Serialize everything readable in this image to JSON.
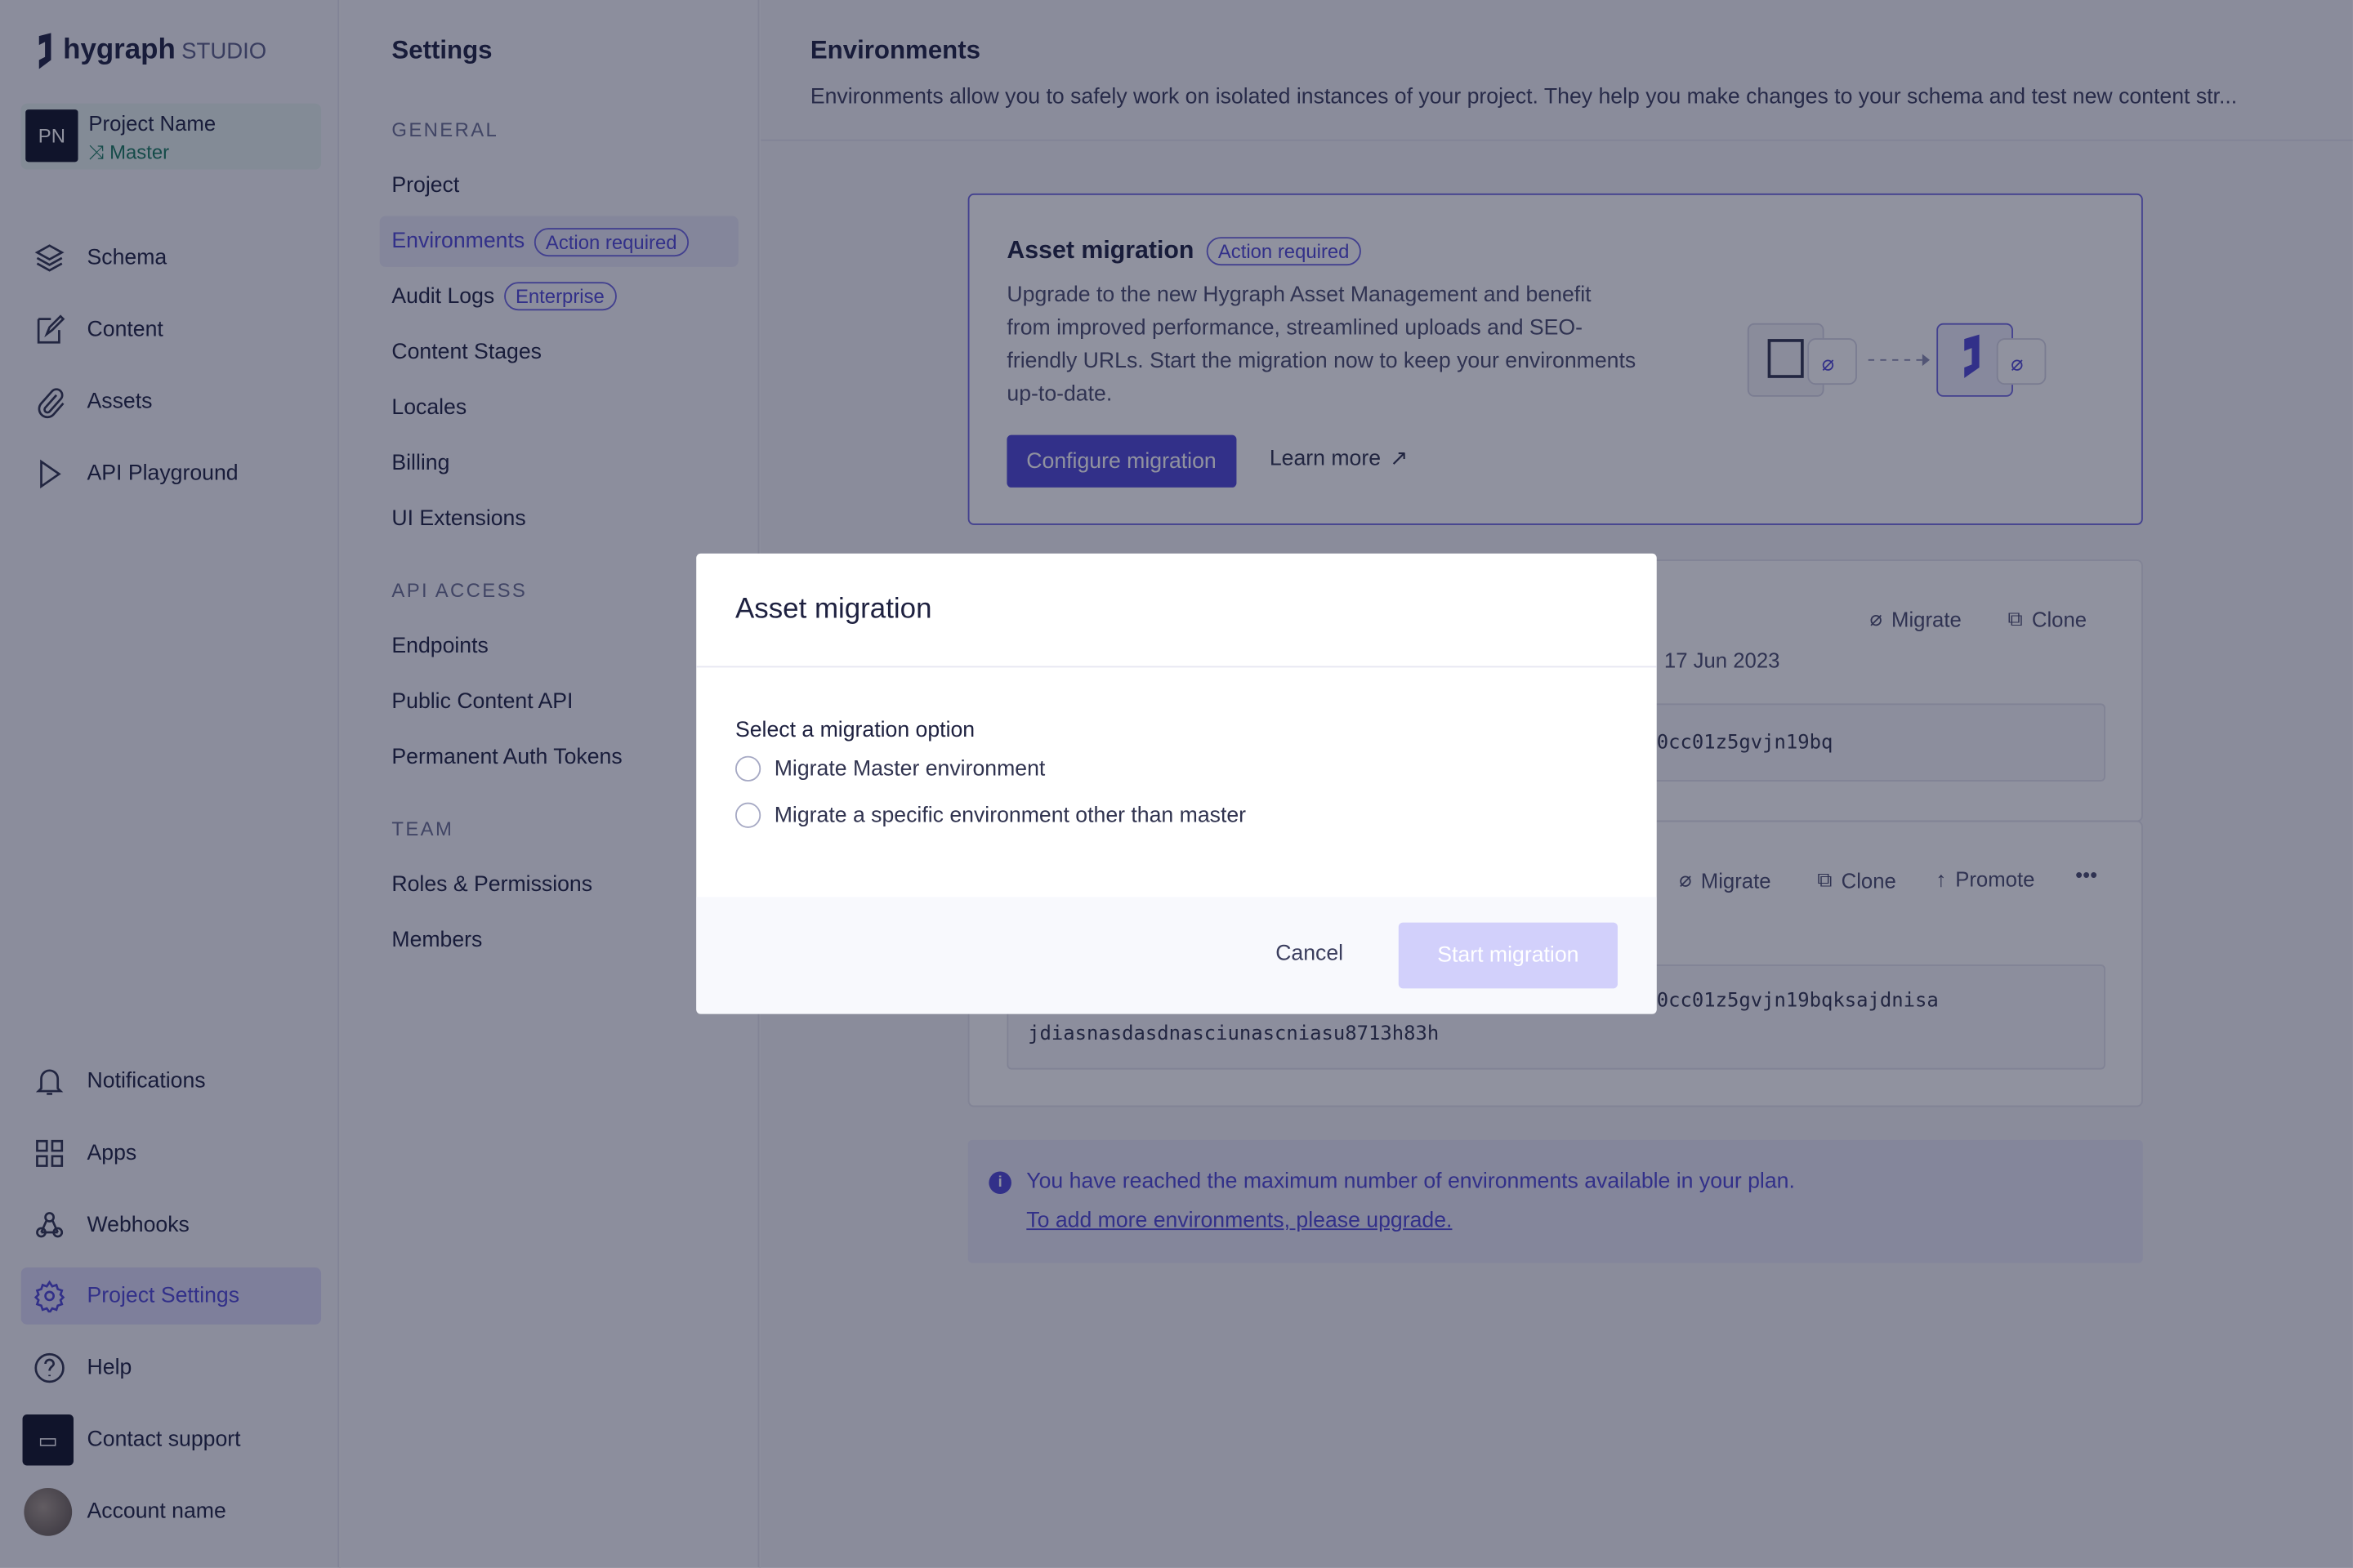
{
  "brand": {
    "name": "hygraph",
    "suffix": "STUDIO"
  },
  "project": {
    "initials": "PN",
    "name": "Project Name",
    "branch": "Master"
  },
  "nav": {
    "top": [
      {
        "label": "Schema",
        "icon": "layers-icon"
      },
      {
        "label": "Content",
        "icon": "edit-icon"
      },
      {
        "label": "Assets",
        "icon": "paperclip-icon"
      },
      {
        "label": "API Playground",
        "icon": "play-icon"
      }
    ],
    "bottom": [
      {
        "label": "Notifications",
        "icon": "bell-icon"
      },
      {
        "label": "Apps",
        "icon": "grid-icon"
      },
      {
        "label": "Webhooks",
        "icon": "webhook-icon"
      },
      {
        "label": "Project Settings",
        "icon": "gear-icon",
        "active": true
      },
      {
        "label": "Help",
        "icon": "help-icon"
      },
      {
        "label": "Contact support",
        "icon": "chat-icon"
      },
      {
        "label": "Account name",
        "icon": "avatar"
      }
    ]
  },
  "settings": {
    "title": "Settings",
    "general": {
      "heading": "GENERAL",
      "items": [
        "Project",
        "Environments",
        "Audit Logs",
        "Content Stages",
        "Locales",
        "Billing",
        "UI Extensions"
      ],
      "env_badge": "Action required",
      "audit_badge": "Enterprise"
    },
    "api": {
      "heading": "API ACCESS",
      "items": [
        "Endpoints",
        "Public Content API",
        "Permanent Auth Tokens"
      ]
    },
    "team": {
      "heading": "TEAM",
      "items": [
        "Roles & Permissions",
        "Members"
      ]
    }
  },
  "main": {
    "title": "Environments",
    "description": "Environments allow you to safely work on isolated instances of your project. They help you make changes to your schema and test new content str...",
    "asset_card": {
      "title": "Asset migration",
      "badge": "Action required",
      "body": "Upgrade to the new Hygraph Asset Management and benefit from improved performance, streamlined uploads and SEO-friendly URLs. Start the migration now to keep your environments up-to-date.",
      "configure": "Configure migration",
      "learn_more": "Learn more"
    },
    "env1": {
      "date": "17 Jun 2023",
      "actions": [
        "Migrate",
        "Clone"
      ],
      "endpoint": "0cc01z5gvjn19bq"
    },
    "env2": {
      "actions": [
        "Migrate",
        "Clone",
        "Promote"
      ],
      "endpoint_line1": "0cc01z5gvjn19bqksajdnisa",
      "endpoint_line2": "jdiasnasdasdnasciunascniasu8713h83h"
    },
    "info": {
      "text": "You have reached the maximum number of environments available in your plan.",
      "link": "To add more environments, please upgrade."
    }
  },
  "modal": {
    "title": "Asset migration",
    "label": "Select a migration option",
    "options": [
      "Migrate Master environment",
      "Migrate a specific environment other than master"
    ],
    "selected": null,
    "cancel": "Cancel",
    "start": "Start migration",
    "start_enabled": false
  },
  "colors": {
    "accent": "#4f46d5",
    "accent_light": "#d2d0fb",
    "branch_green": "#177a5e"
  }
}
